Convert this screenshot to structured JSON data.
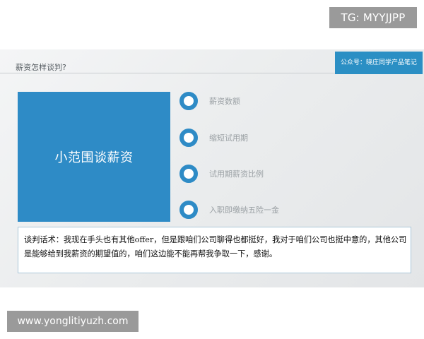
{
  "watermark_top": "TG: MYYJJPP",
  "watermark_bottom": "www.yonglitiyuzh.com",
  "slide": {
    "title": "薪资怎样谈判?",
    "account_tag": "公众号：晓庄同学产品笔记",
    "box_label": "小范围谈薪资",
    "items": [
      {
        "label": "薪资数额"
      },
      {
        "label": "缩短试用期"
      },
      {
        "label": "试用期薪资比例"
      },
      {
        "label": "入职即缴纳五险一金"
      }
    ],
    "script": "谈判话术：我现在手头也有其他offer，但是跟咱们公司聊得也都挺好，我对于咱们公司也挺中意的，其他公司是能够给到我薪资的期望值的，咱们这边能不能再帮我争取一下，感谢。"
  },
  "colors": {
    "accent": "#2e8bc6",
    "watermark_bg": "#9a9a9a"
  },
  "icons": [
    "ring-bullet-icon"
  ]
}
